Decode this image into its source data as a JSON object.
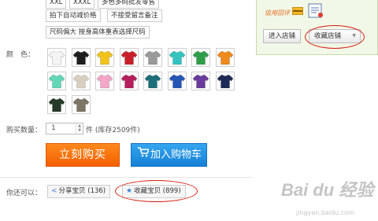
{
  "size_options": {
    "row0": [
      "XXL",
      "XXXL",
      "多色多码批发零售"
    ],
    "row1": [
      "拍下自动减价格",
      "不接受留言备注"
    ],
    "row2": [
      "尺码偏大 按身高体重表选择尺码"
    ]
  },
  "color": {
    "label": "颜　色：",
    "swatches": [
      {
        "name": "white",
        "hex": "#f4f4f4"
      },
      {
        "name": "black",
        "hex": "#1e1e1e"
      },
      {
        "name": "yellow",
        "hex": "#f2c21a"
      },
      {
        "name": "red",
        "hex": "#c8202a"
      },
      {
        "name": "grey",
        "hex": "#9a9a9a"
      },
      {
        "name": "aqua",
        "hex": "#33c4c0"
      },
      {
        "name": "green",
        "hex": "#2f9e4a"
      },
      {
        "name": "orange",
        "hex": "#f08a1c"
      },
      {
        "name": "mint",
        "hex": "#63d8b8"
      },
      {
        "name": "beige",
        "hex": "#d8cfc0"
      },
      {
        "name": "pink",
        "hex": "#f3a6c8"
      },
      {
        "name": "purple-red",
        "hex": "#b51f5e"
      },
      {
        "name": "teal",
        "hex": "#1c6f78"
      },
      {
        "name": "royal-blue",
        "hex": "#2457b5"
      },
      {
        "name": "purple",
        "hex": "#6a3b9c"
      },
      {
        "name": "navy",
        "hex": "#1d2a55"
      },
      {
        "name": "dark-green",
        "hex": "#26392a"
      },
      {
        "name": "khaki",
        "hex": "#7d7565"
      }
    ]
  },
  "quantity": {
    "label": "购买数量：",
    "value": "1",
    "unit": "件 (库存2509件)"
  },
  "buttons": {
    "buy_now": "立刻购买",
    "add_to_cart": "加入购物车"
  },
  "share": {
    "label": "你还可以：",
    "share_item": "分享宝贝 (136)",
    "favorite_item": "收藏宝贝 (899)"
  },
  "shop": {
    "credit_label": "信用回评",
    "enter_shop": "进入店铺",
    "favorite_shop": "收藏店铺"
  },
  "watermark": {
    "logo": "Bai du 经验",
    "sub": "jingyan.baidu.com"
  },
  "colors": {
    "accent_orange": "#f35f00",
    "accent_blue": "#1580d6",
    "annotation_red": "#d81c10"
  }
}
